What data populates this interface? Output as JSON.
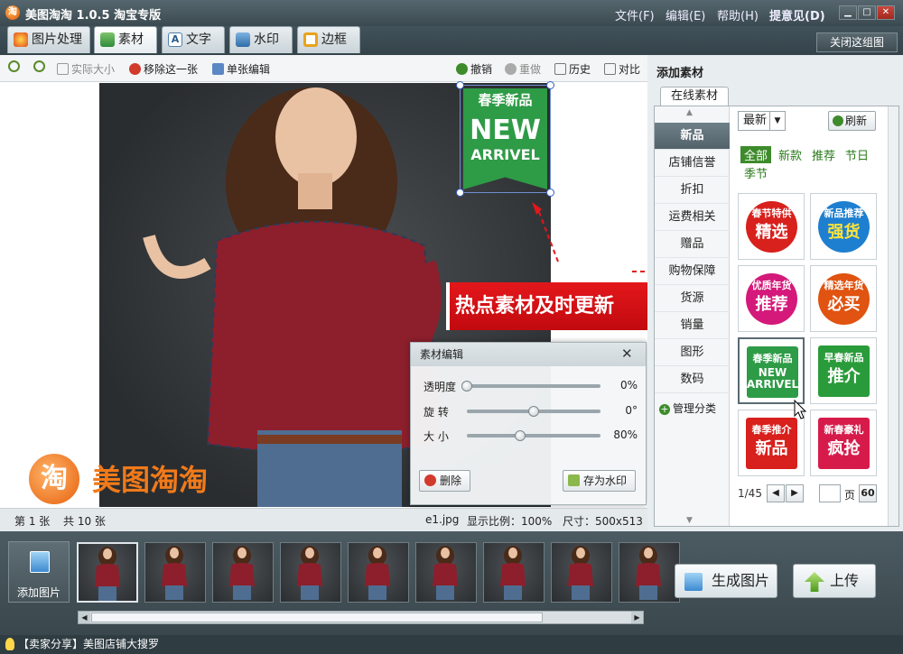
{
  "app": {
    "title": "美图淘淘 1.0.5 淘宝专版"
  },
  "menu": {
    "file": "文件(F)",
    "edit": "编辑(E)",
    "help": "帮助(H)",
    "feedback": "提意见(D)"
  },
  "window": {
    "minimize": "▁",
    "maximize": "□",
    "close": "✕"
  },
  "tabs": [
    {
      "label": "图片处理"
    },
    {
      "label": "素材"
    },
    {
      "label": "文字"
    },
    {
      "label": "水印"
    },
    {
      "label": "边框"
    }
  ],
  "close_group": "关闭这组图",
  "toolbar": {
    "actual_size": "实际大小",
    "remove_this": "移除这一张",
    "single_edit": "单张编辑",
    "undo": "撤销",
    "redo": "重做",
    "history": "历史",
    "compare": "对比"
  },
  "canvas": {
    "sticker": {
      "line1": "春季新品",
      "line2": "NEW",
      "line3": "ARRIVEL"
    },
    "watermark_text": "美图淘淘",
    "watermark_logo_char": "淘"
  },
  "promo_banner": "热点素材及时更新",
  "dialog": {
    "title": "素材编辑",
    "close": "✕",
    "sliders": [
      {
        "label": "透明度",
        "value": "0%",
        "level": 0.0
      },
      {
        "label": "旋 转",
        "value": "0°",
        "level": 0.5
      },
      {
        "label": "大 小",
        "value": "80%",
        "level": 0.4
      }
    ],
    "delete": "删除",
    "save_watermark": "存为水印"
  },
  "status": {
    "page": "第 1 张",
    "total": "共 10 张",
    "file": "e1.jpg",
    "zoom": "显示比例：100%",
    "size": "尺寸：500x513"
  },
  "filmstrip": {
    "add_label": "添加图片",
    "count": 9
  },
  "actions": {
    "generate": "生成图片",
    "upload": "上传"
  },
  "footer": {
    "text": "【卖家分享】美图店铺大搜罗"
  },
  "panel": {
    "title": "添加素材",
    "online_tab": "在线素材",
    "categories": [
      "新品",
      "店铺信誉",
      "折扣",
      "运费相关",
      "赠品",
      "购物保障",
      "货源",
      "销量",
      "图形",
      "数码"
    ],
    "manage": "管理分类",
    "sort": "最新",
    "refresh": "刷新",
    "filters": [
      "全部",
      "新款",
      "推荐",
      "节日",
      "季节"
    ],
    "stickers": [
      {
        "top": "春节特供",
        "main": "精选",
        "color": "#d8201c"
      },
      {
        "top": "新品推荐",
        "main": "强货",
        "color": "#1e7fd0"
      },
      {
        "top": "优质年货",
        "main": "推荐",
        "color": "#d4197a"
      },
      {
        "top": "精选年货",
        "main": "必买",
        "color": "#e05310"
      },
      {
        "top": "春季新品",
        "main": "NEW ARRIVEL",
        "color": "#2e9b46"
      },
      {
        "top": "早春新品",
        "main": "推介",
        "color": "#2a9b3a"
      },
      {
        "top": "春季推介",
        "main": "新品",
        "color": "#d8201c"
      },
      {
        "top": "新春豪礼",
        "main": "疯抢",
        "color": "#d61b4a"
      }
    ],
    "pager": "1/45",
    "page_unit": "页",
    "go": "60"
  },
  "colors": {
    "accent": "#e3171b",
    "title_bg": "#3b4a51",
    "green": "#2e9b46"
  }
}
